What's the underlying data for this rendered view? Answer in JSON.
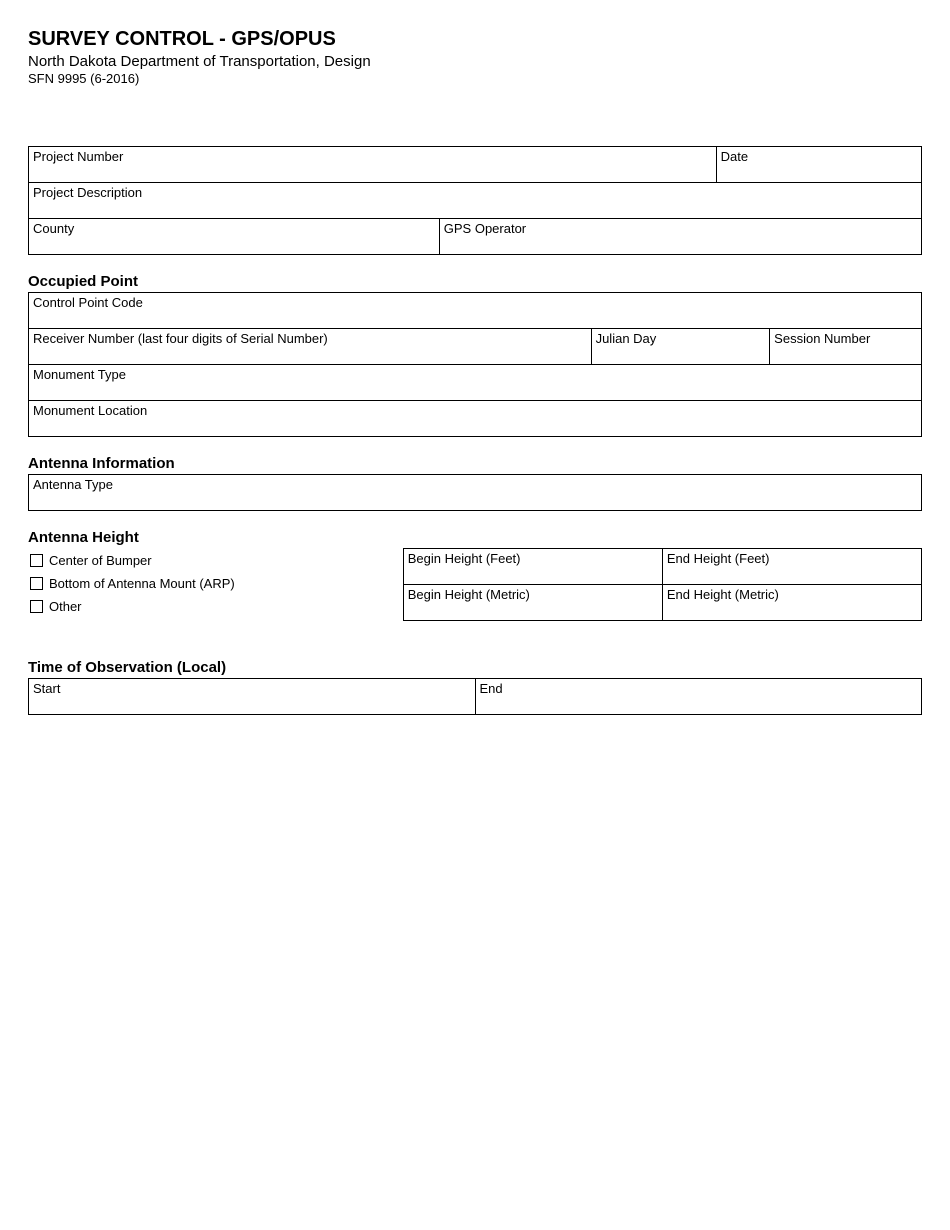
{
  "header": {
    "title": "SURVEY CONTROL - GPS/OPUS",
    "subtitle": "North Dakota Department of Transportation, Design",
    "formNumber": "SFN 9995 (6-2016)"
  },
  "projectInfo": {
    "projectNumberLabel": "Project Number",
    "dateLabel": "Date",
    "projectDescriptionLabel": "Project Description",
    "countyLabel": "County",
    "gpsOperatorLabel": "GPS Operator"
  },
  "occupiedPoint": {
    "sectionTitle": "Occupied Point",
    "controlPointCodeLabel": "Control Point Code",
    "receiverNumberLabel": "Receiver Number (last four digits of Serial Number)",
    "julianDayLabel": "Julian Day",
    "sessionNumberLabel": "Session Number",
    "monumentTypeLabel": "Monument Type",
    "monumentLocationLabel": "Monument Location"
  },
  "antennaInfo": {
    "sectionTitle": "Antenna Information",
    "antennaTypeLabel": "Antenna Type"
  },
  "antennaHeight": {
    "sectionTitle": "Antenna Height",
    "centerOfBumperLabel": "Center of Bumper",
    "bottomOfAntennaLabel": "Bottom of Antenna Mount (ARP)",
    "otherLabel": "Other",
    "beginHeightFeetLabel": "Begin Height (Feet)",
    "endHeightFeetLabel": "End Height (Feet)",
    "beginHeightMetricLabel": "Begin Height (Metric)",
    "endHeightMetricLabel": "End Height (Metric)"
  },
  "timeOfObservation": {
    "sectionTitle": "Time of Observation (Local)",
    "startLabel": "Start",
    "endLabel": "End"
  }
}
